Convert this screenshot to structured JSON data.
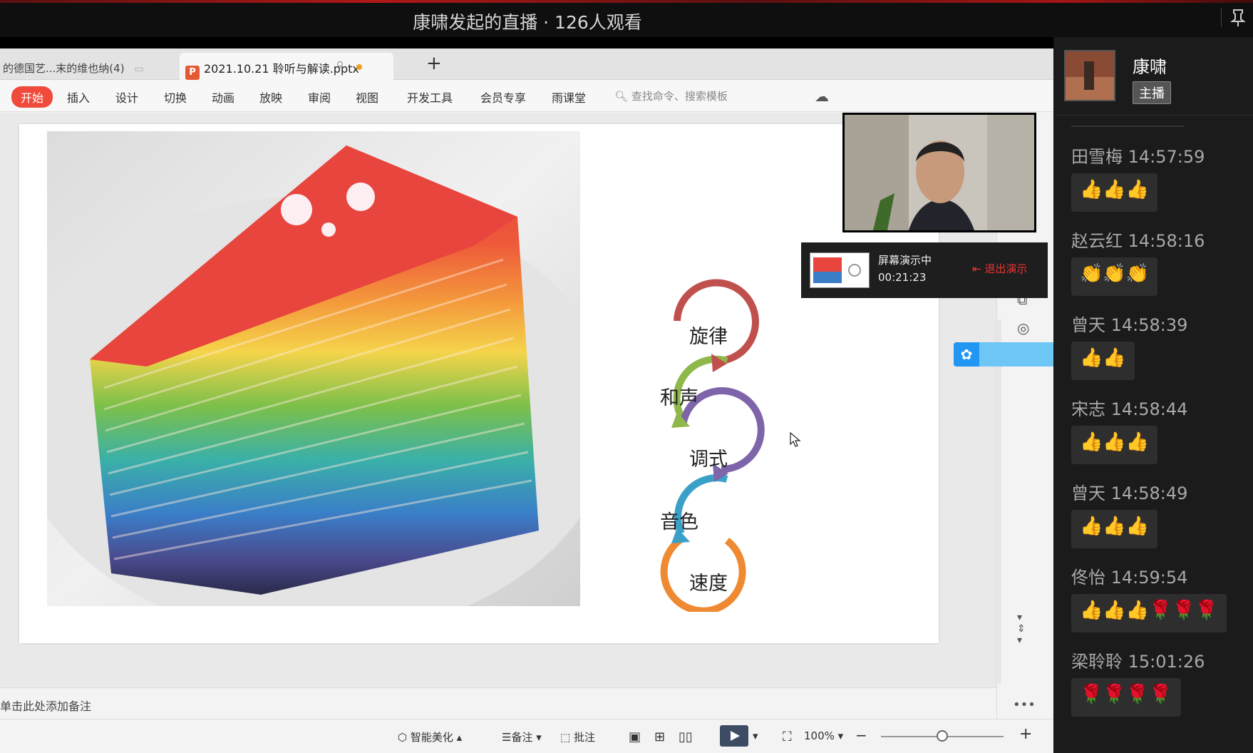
{
  "live": {
    "title": "康啸发起的直播 · 126人观看"
  },
  "wps": {
    "tab_inactive": "的德国艺...末的维也纳(4)",
    "tab_active_icon": "P",
    "tab_active": "2021.10.21 聆听与解读.pptx",
    "ribbon": [
      "开始",
      "插入",
      "设计",
      "切换",
      "动画",
      "放映",
      "审阅",
      "视图",
      "开发工具",
      "会员专享",
      "雨课堂"
    ],
    "search_placeholder": "查找命令、搜索模板",
    "notes_placeholder": "单击此处添加备注",
    "status": {
      "beautify": "智能美化",
      "notes": "备注",
      "comments": "批注",
      "zoom": "100%",
      "zoom_fraction": 0.5
    }
  },
  "slide": {
    "cycle_items": [
      {
        "label": "旋律",
        "color": "#c0504d"
      },
      {
        "label": "和声",
        "color": "#8fb84a"
      },
      {
        "label": "调式",
        "color": "#7e64a8"
      },
      {
        "label": "音色",
        "color": "#3aa0c8"
      },
      {
        "label": "速度",
        "color": "#ef8a32"
      }
    ]
  },
  "presenting": {
    "label": "屏幕演示中",
    "time": "00:21:23",
    "exit": "退出演示"
  },
  "chat": {
    "host_name": "康啸",
    "host_badge": "主播",
    "messages": [
      {
        "user": "田雪梅",
        "time": "14:57:59",
        "emojis": "👍👍👍"
      },
      {
        "user": "赵云红",
        "time": "14:58:16",
        "emojis": "👏👏👏"
      },
      {
        "user": "曾天",
        "time": "14:58:39",
        "emojis": "👍👍"
      },
      {
        "user": "宋志",
        "time": "14:58:44",
        "emojis": "👍👍👍"
      },
      {
        "user": "曾天",
        "time": "14:58:49",
        "emojis": "👍👍👍"
      },
      {
        "user": "佟怡",
        "time": "14:59:54",
        "emojis": "👍👍👍🌹🌹🌹"
      },
      {
        "user": "梁聆聆",
        "time": "15:01:26",
        "emojis": "🌹🌹🌹🌹"
      }
    ]
  }
}
